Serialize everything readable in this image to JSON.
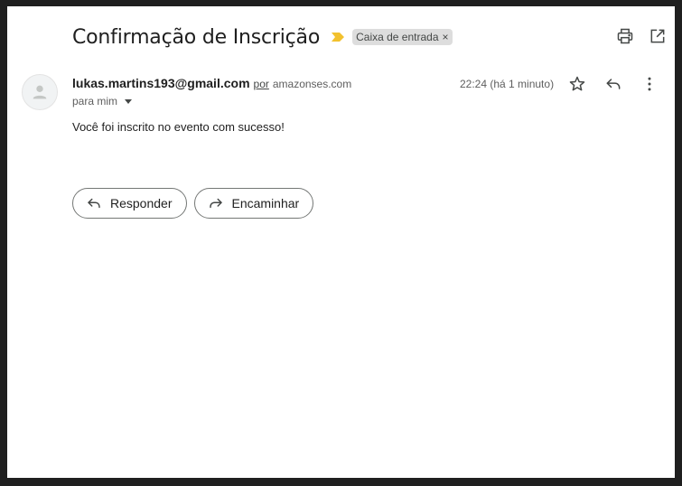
{
  "email": {
    "subject": "Confirmação de Inscrição",
    "label_chip": "Caixa de entrada",
    "label_remove_glyph": "×",
    "sender_email": "lukas.martins193@gmail.com",
    "via_word": "por",
    "via_domain": "amazonses.com",
    "recipient_text": "para mim",
    "timestamp": "22:24 (há 1 minuto)",
    "body": "Você foi inscrito no evento com sucesso!"
  },
  "actions": {
    "reply_label": "Responder",
    "forward_label": "Encaminhar"
  },
  "icons": {
    "importance": "importance-marker-icon",
    "print": "print-icon",
    "open_new_window": "open-in-new-window-icon",
    "avatar": "person-icon",
    "star": "star-icon",
    "reply": "reply-icon",
    "more": "more-vert-icon",
    "forward": "forward-icon"
  },
  "colors": {
    "importance_marker": "#f2c12e",
    "chip_background": "#dddddd",
    "text_primary": "#1f1f1f",
    "text_secondary": "#5e5e5e"
  }
}
